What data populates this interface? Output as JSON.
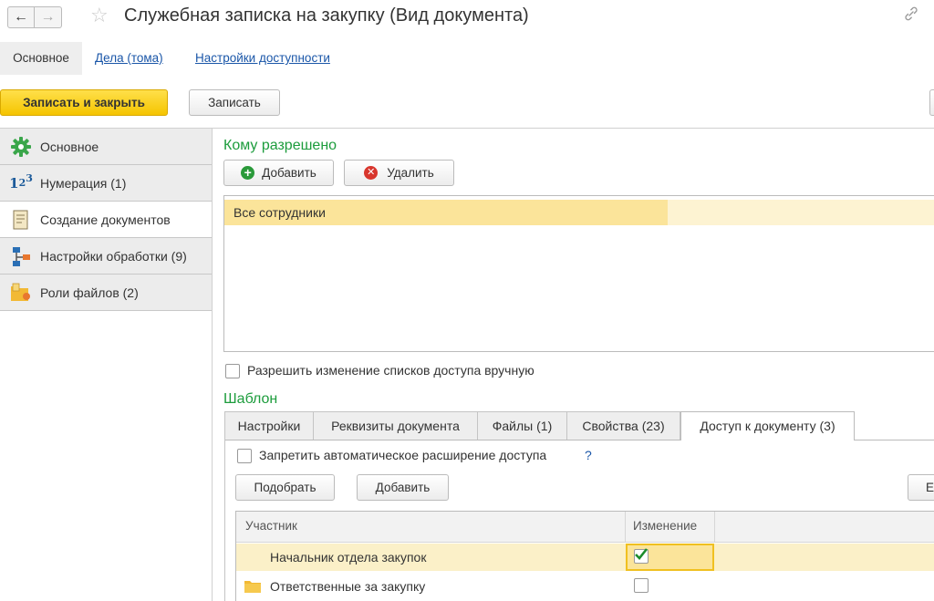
{
  "header": {
    "back_icon": "arrow-left-icon",
    "forward_icon": "arrow-right-icon",
    "favorite_icon": "star-icon",
    "title": "Служебная записка на закупку (Вид документа)",
    "link_icon": "link-icon"
  },
  "section_tabs": [
    {
      "label": "Основное"
    },
    {
      "label": "Дела (тома)"
    },
    {
      "label": "Настройки доступности"
    }
  ],
  "toolbar": {
    "save_close_label": "Записать и закрыть",
    "save_label": "Записать"
  },
  "sidebar": {
    "items": [
      {
        "label": "Основное",
        "icon": "gear-icon"
      },
      {
        "label": "Нумерация (1)",
        "icon": "numbering-icon"
      },
      {
        "label": "Создание документов",
        "icon": "document-icon"
      },
      {
        "label": "Настройки обработки (9)",
        "icon": "workflow-icon"
      },
      {
        "label": "Роли файлов (2)",
        "icon": "file-roles-icon"
      }
    ]
  },
  "allowed": {
    "title": "Кому разрешено",
    "add_label": "Добавить",
    "delete_label": "Удалить",
    "rows": [
      {
        "label": "Все сотрудники"
      }
    ]
  },
  "manual_access": {
    "label": "Разрешить изменение списков доступа вручную",
    "checked": false
  },
  "template": {
    "title": "Шаблон",
    "tabs": [
      {
        "label": "Настройки"
      },
      {
        "label": "Реквизиты документа"
      },
      {
        "label": "Файлы (1)"
      },
      {
        "label": "Свойства (23)"
      },
      {
        "label": "Доступ к документу (3)"
      }
    ],
    "active_tab": "Доступ к документу (3)",
    "prohibit_label": "Запретить автоматическое расширение доступа",
    "prohibit_help": "?",
    "pick_label": "Подобрать",
    "add_label": "Добавить",
    "more_label": "Ещ",
    "columns": [
      "Участник",
      "Изменение"
    ],
    "rows": [
      {
        "participant": "Начальник отдела закупок",
        "change": true
      },
      {
        "participant": "Ответственные за закупку",
        "change": false,
        "icon": "folder-icon"
      }
    ]
  },
  "colors": {
    "primary_button": "#f5c400",
    "selection": "#fbe49a",
    "green_title": "#1c9c3c",
    "link": "#1a56a8"
  }
}
